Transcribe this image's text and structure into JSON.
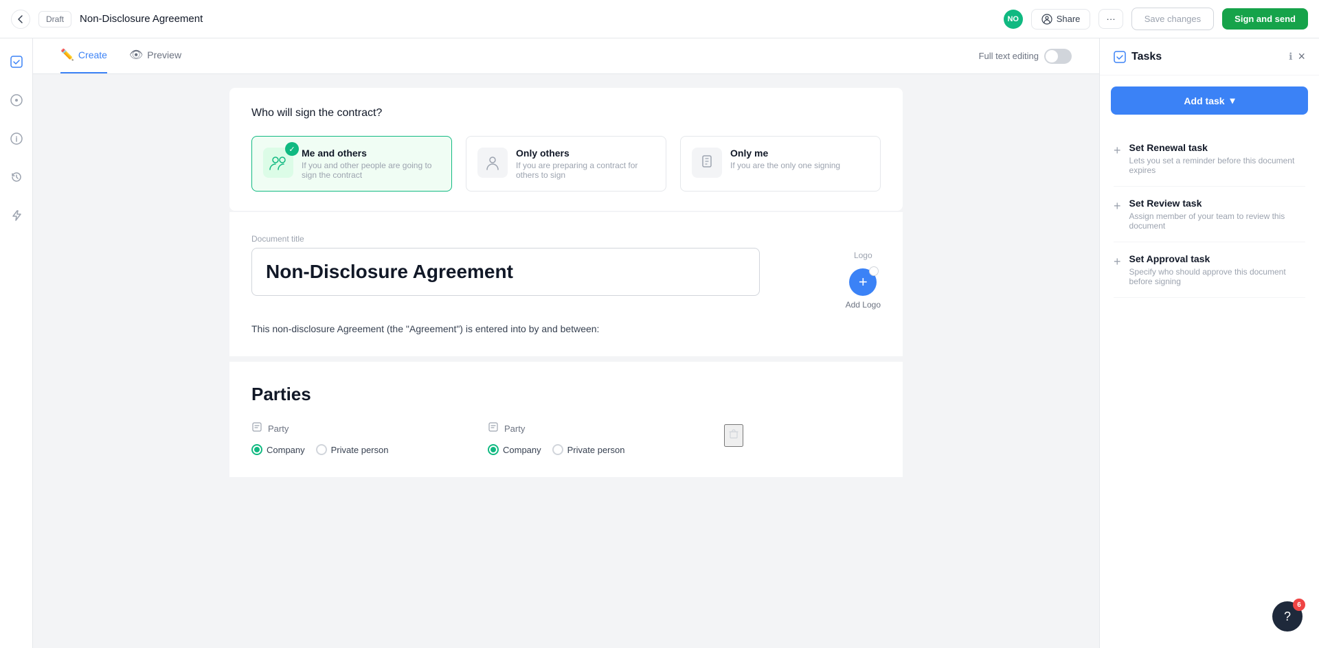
{
  "topbar": {
    "back_label": "←",
    "draft_label": "Draft",
    "title": "Non-Disclosure Agreement",
    "no_badge": "NO",
    "share_label": "Share",
    "more_label": "···",
    "save_label": "Save changes",
    "sign_label": "Sign and send"
  },
  "tabs": {
    "create_label": "Create",
    "preview_label": "Preview",
    "full_text_label": "Full text editing"
  },
  "signing": {
    "question": "Who will sign the contract?",
    "options": [
      {
        "id": "me_and_others",
        "title": "Me and others",
        "desc": "If you and other people are going to sign the contract",
        "selected": true
      },
      {
        "id": "only_others",
        "title": "Only others",
        "desc": "If you are preparing a contract for others to sign",
        "selected": false
      },
      {
        "id": "only_me",
        "title": "Only me",
        "desc": "If you are the only one signing",
        "selected": false
      }
    ]
  },
  "document": {
    "logo_placeholder": "Logo",
    "logo_add_label": "Add Logo",
    "title_label": "Document title",
    "title_value": "Non-Disclosure Agreement",
    "body_text": "This non-disclosure Agreement (the \"Agreement\") is entered into by and between:"
  },
  "parties": {
    "section_title": "Parties",
    "party1": {
      "label": "Party",
      "type_company": "Company",
      "type_private": "Private person",
      "selected": "company"
    },
    "party2": {
      "label": "Party",
      "type_company": "Company",
      "type_private": "Private person",
      "selected": "company"
    }
  },
  "tasks_panel": {
    "title": "Tasks",
    "add_task_label": "Add task",
    "close_label": "×",
    "tasks": [
      {
        "name": "Set Renewal task",
        "desc": "Lets you set a reminder before this document expires"
      },
      {
        "name": "Set Review task",
        "desc": "Assign member of your team to review this document"
      },
      {
        "name": "Set Approval task",
        "desc": "Specify who should approve this document before signing"
      }
    ]
  },
  "help": {
    "badge_count": "6",
    "icon": "?"
  }
}
